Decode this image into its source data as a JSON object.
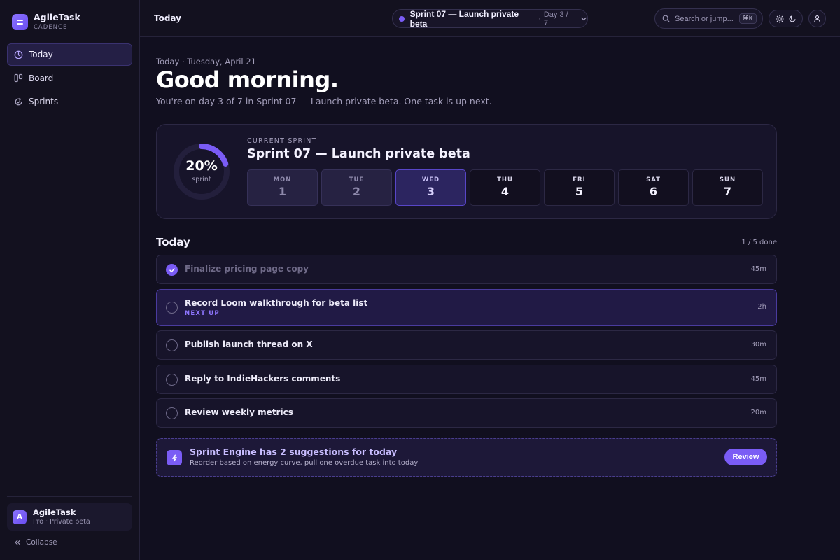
{
  "app": {
    "name": "AgileTask",
    "subtitle": "CADENCE"
  },
  "sidebar": {
    "items": [
      {
        "label": "Today",
        "icon": "clock-icon",
        "active": true
      },
      {
        "label": "Board",
        "icon": "board-icon",
        "active": false
      },
      {
        "label": "Sprints",
        "icon": "sprint-cycle-icon",
        "active": false
      }
    ],
    "account": {
      "initial": "A",
      "name": "AgileTask",
      "plan": "Pro · Private beta"
    },
    "collapse_label": "Collapse"
  },
  "topbar": {
    "title": "Today",
    "sprint_pill": {
      "name": "Sprint 07 — Launch private beta",
      "separator": "·",
      "day": "Day 3 / 7"
    },
    "search": {
      "placeholder": "Search or jump...",
      "shortcut": "⌘K"
    }
  },
  "main": {
    "dateline": "Today · Tuesday, April 21",
    "greeting": "Good morning.",
    "subline": "You're on day 3 of 7 in Sprint 07 — Launch private beta. One task is up next.",
    "sprint_card": {
      "progress_percent": 20,
      "progress_label": "20%",
      "progress_caption": "sprint",
      "kicker": "CURRENT SPRINT",
      "title": "Sprint 07 — Launch private beta",
      "days": [
        {
          "name": "MON",
          "num": "1",
          "state": "past"
        },
        {
          "name": "TUE",
          "num": "2",
          "state": "past"
        },
        {
          "name": "WED",
          "num": "3",
          "state": "current"
        },
        {
          "name": "THU",
          "num": "4",
          "state": "future"
        },
        {
          "name": "FRI",
          "num": "5",
          "state": "future"
        },
        {
          "name": "SAT",
          "num": "6",
          "state": "future"
        },
        {
          "name": "SUN",
          "num": "7",
          "state": "future"
        }
      ]
    },
    "today": {
      "heading": "Today",
      "count": "1 / 5 done",
      "tasks": [
        {
          "title": "Finalize pricing page copy",
          "duration": "45m",
          "done": true
        },
        {
          "title": "Record Loom walkthrough for beta list",
          "tag": "NEXT UP",
          "duration": "2h",
          "done": false
        },
        {
          "title": "Publish launch thread on X",
          "duration": "30m",
          "done": false
        },
        {
          "title": "Reply to IndieHackers comments",
          "duration": "45m",
          "done": false
        },
        {
          "title": "Review weekly metrics",
          "duration": "20m",
          "done": false
        }
      ]
    },
    "engine": {
      "title": "Sprint Engine has 2 suggestions for today",
      "subtitle": "Reorder based on energy curve, pull one overdue task into today",
      "button": "Review"
    }
  },
  "colors": {
    "accent": "#7a5cf5",
    "background": "#110f1f",
    "surface": "#17142a"
  }
}
